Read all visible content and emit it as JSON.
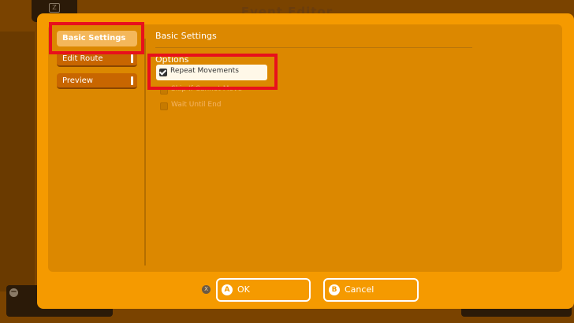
{
  "window": {
    "title": "Event Editor"
  },
  "sidebar": {
    "items": [
      {
        "label": "Basic Settings",
        "state": "active"
      },
      {
        "label": "Edit Route",
        "state": "inactive"
      },
      {
        "label": "Preview",
        "state": "inactive"
      }
    ]
  },
  "main": {
    "section_title": "Basic Settings",
    "options_label": "Options",
    "options": [
      {
        "label": "Repeat Movements",
        "checked": true
      },
      {
        "label": "Skip If Cannot Move",
        "checked": false
      },
      {
        "label": "Wait Until End",
        "checked": false
      }
    ]
  },
  "footer": {
    "x_glyph": "X",
    "ok": {
      "glyph": "A",
      "label": "OK"
    },
    "cancel": {
      "glyph": "B",
      "label": "Cancel"
    }
  },
  "colors": {
    "dialog_bg": "#f59a00",
    "panel_bg": "#dc8800",
    "active_tab": "#f4b75a",
    "highlight": "#e8101c"
  },
  "icons": {
    "top_tab": "zoom-icon",
    "bottom_left": "minus-icon",
    "check": "check-icon"
  }
}
